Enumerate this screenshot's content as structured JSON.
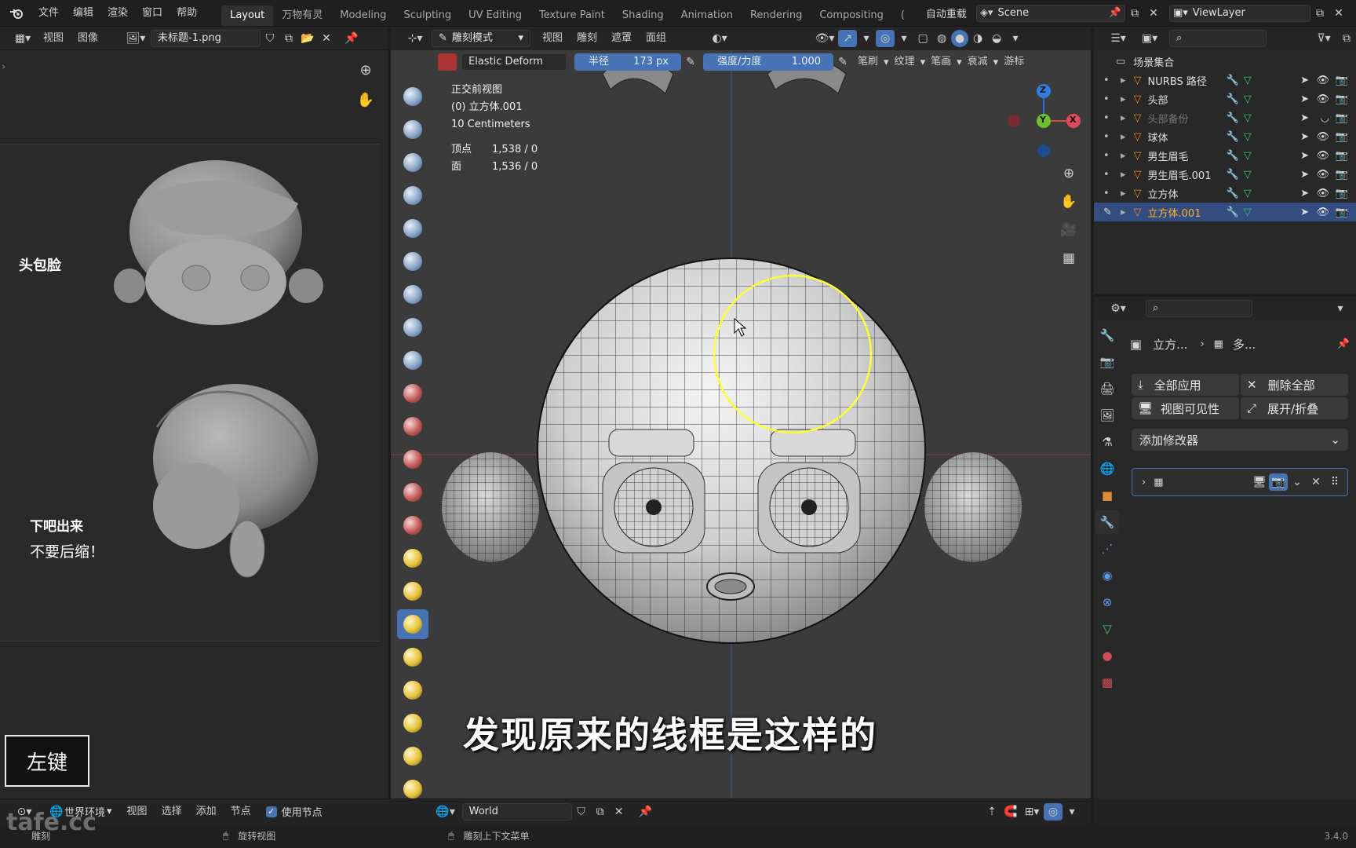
{
  "topbar": {
    "menus": [
      "文件",
      "编辑",
      "渲染",
      "窗口",
      "帮助"
    ],
    "workspaces": [
      "Layout",
      "万物有灵",
      "Modeling",
      "Sculpting",
      "UV Editing",
      "Texture Paint",
      "Shading",
      "Animation",
      "Rendering",
      "Compositing",
      "("
    ],
    "active_workspace": "Layout",
    "autosave": "自动重载",
    "scene": "Scene",
    "view_layer": "ViewLayer"
  },
  "image_editor": {
    "menus": [
      "视图",
      "图像"
    ],
    "image_name": "未标题-1.png",
    "ref_labels": {
      "label1": "头包脸",
      "label2": "下吧出来",
      "label3": "不要后缩！"
    },
    "key_overlay": "左键"
  },
  "viewport": {
    "mode": "雕刻模式",
    "menus": [
      "视图",
      "雕刻",
      "遮罩",
      "面组"
    ],
    "brush_name": "Elastic Deform",
    "radius_label": "半径",
    "radius_value": "173 px",
    "strength_label": "强度/力度",
    "strength_value": "1.000",
    "dropdowns": [
      "笔刷",
      "纹理",
      "笔画",
      "衰减",
      "游标"
    ],
    "overlay": {
      "view_name": "正交前视图",
      "object": "(0) 立方体.001",
      "scale": "10 Centimeters",
      "verts_label": "顶点",
      "verts": "1,538 / 0",
      "faces_label": "面",
      "faces": "1,536 / 0"
    },
    "gizmo": {
      "z": "Z",
      "y": "Y",
      "x": "X"
    },
    "subtitle": "发现原来的线框是这样的"
  },
  "outliner": {
    "root": "场景集合",
    "items": [
      {
        "name": "NURBS 路径",
        "selected": false,
        "dim": false
      },
      {
        "name": "头部",
        "selected": false,
        "dim": false
      },
      {
        "name": "头部备份",
        "selected": false,
        "dim": true
      },
      {
        "name": "球体",
        "selected": false,
        "dim": false
      },
      {
        "name": "男生眉毛",
        "selected": false,
        "dim": false
      },
      {
        "name": "男生眉毛.001",
        "selected": false,
        "dim": false
      },
      {
        "name": "立方体",
        "selected": false,
        "dim": false
      },
      {
        "name": "立方体.001",
        "selected": true,
        "dim": false
      }
    ]
  },
  "properties": {
    "breadcrumb_obj": "立方...",
    "breadcrumb_mod": "多...",
    "apply_all": "全部应用",
    "delete_all": "删除全部",
    "viewport_vis": "视图可见性",
    "expand_collapse": "展开/折叠",
    "add_modifier": "添加修改器"
  },
  "node_bar": {
    "world_env": "世界环境",
    "menus": [
      "视图",
      "选择",
      "添加",
      "节点"
    ],
    "use_nodes": "使用节点",
    "world": "World"
  },
  "statusbar": {
    "left": "雕刻",
    "middle": "旋转视图",
    "right": "雕刻上下文菜单",
    "version": "3.4.0",
    "watermark": "tafe.cc"
  },
  "colors": {
    "accent": "#4772b3",
    "selected_text": "#ffaf29",
    "brush_circle": "#ffff33"
  }
}
